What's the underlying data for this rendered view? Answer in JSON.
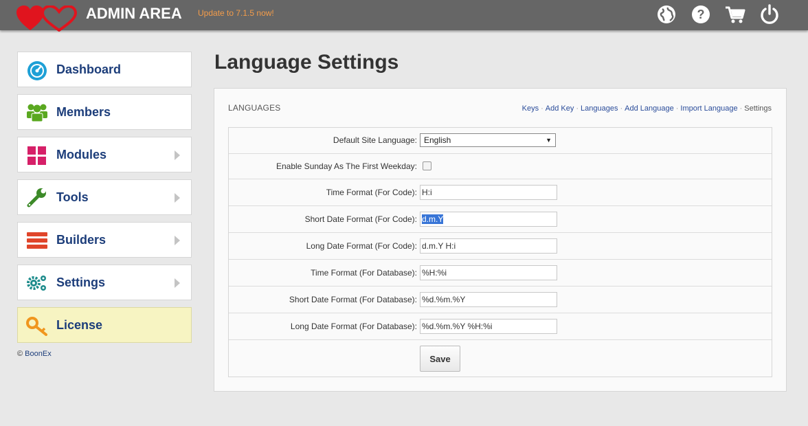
{
  "header": {
    "title": "ADMIN AREA",
    "update_link": "Update to 7.1.5 now!",
    "icons": [
      "globe-icon",
      "help-icon",
      "cart-icon",
      "power-icon"
    ],
    "bg_color": "#666666",
    "update_color": "#f39c4a"
  },
  "sidebar": {
    "items": [
      {
        "label": "Dashboard",
        "icon": "dashboard-gauge-icon",
        "has_arrow": false
      },
      {
        "label": "Members",
        "icon": "members-icon",
        "has_arrow": false
      },
      {
        "label": "Modules",
        "icon": "modules-grid-icon",
        "has_arrow": true
      },
      {
        "label": "Tools",
        "icon": "wrench-icon",
        "has_arrow": true
      },
      {
        "label": "Builders",
        "icon": "builders-bars-icon",
        "has_arrow": true
      },
      {
        "label": "Settings",
        "icon": "gears-icon",
        "has_arrow": true
      },
      {
        "label": "License",
        "icon": "key-icon",
        "has_arrow": false
      }
    ],
    "copyright_symbol": "©",
    "copyright_link": "BoonEx"
  },
  "main": {
    "page_title": "Language Settings",
    "panel_title": "LANGUAGES",
    "panel_links": [
      {
        "label": "Keys",
        "current": false
      },
      {
        "label": "Add Key",
        "current": false
      },
      {
        "label": "Languages",
        "current": false
      },
      {
        "label": "Add Language",
        "current": false
      },
      {
        "label": "Import Language",
        "current": false
      },
      {
        "label": "Settings",
        "current": true
      }
    ],
    "form": {
      "default_language": {
        "label": "Default Site Language:",
        "value": "English"
      },
      "sunday_first": {
        "label": "Enable Sunday As The First Weekday:",
        "checked": false
      },
      "fields": [
        {
          "label": "Time Format (For Code):",
          "value": "H:i",
          "selected": false
        },
        {
          "label": "Short Date Format (For Code):",
          "value": "d.m.Y",
          "selected": true
        },
        {
          "label": "Long Date Format (For Code):",
          "value": "d.m.Y H:i",
          "selected": false
        },
        {
          "label": "Time Format (For Database):",
          "value": "%H:%i",
          "selected": false
        },
        {
          "label": "Short Date Format (For Database):",
          "value": "%d.%m.%Y",
          "selected": false
        },
        {
          "label": "Long Date Format (For Database):",
          "value": "%d.%m.%Y %H:%i",
          "selected": false
        }
      ],
      "save_label": "Save"
    }
  }
}
